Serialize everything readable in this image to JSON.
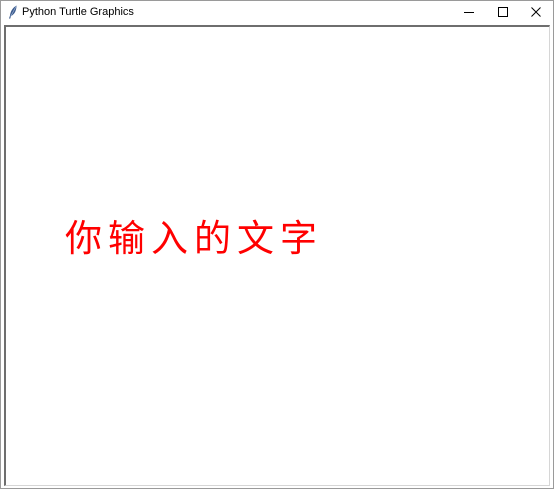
{
  "window": {
    "title": "Python Turtle Graphics",
    "icon": "feather-icon",
    "controls": {
      "minimize": "minimize-icon",
      "maximize": "maximize-icon",
      "close": "close-icon"
    }
  },
  "canvas": {
    "background": "#ffffff",
    "text": "你输入的文字",
    "text_color": "#ff0000"
  }
}
